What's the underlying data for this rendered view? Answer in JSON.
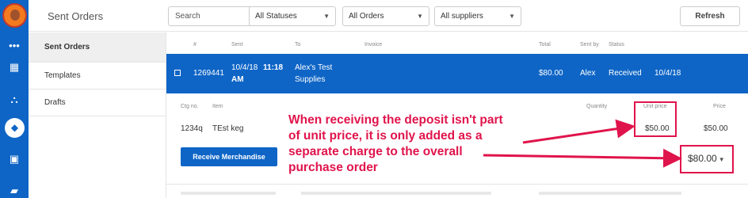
{
  "header": {
    "title": "Sent Orders",
    "search_placeholder": "Search",
    "status_filter": "All Statuses",
    "orders_filter": "All Orders",
    "suppliers_filter": "All suppliers",
    "refresh_label": "Refresh"
  },
  "sidebar": {
    "items": [
      {
        "label": "Sent Orders",
        "active": true
      },
      {
        "label": "Templates",
        "active": false
      },
      {
        "label": "Drafts",
        "active": false
      }
    ]
  },
  "table": {
    "columns": [
      "#",
      "Sent",
      "To",
      "Invoice",
      "Total",
      "Sent by",
      "Status"
    ],
    "selected_row": {
      "number": "1269441",
      "sent_date": "10/4/18",
      "sent_time": "11:18",
      "sent_ampm": "AM",
      "to_line1": "Alex's Test",
      "to_line2": "Supplies",
      "total": "$80.00",
      "sent_by": "Alex",
      "status": "Received",
      "status_date": "10/4/18"
    }
  },
  "detail": {
    "columns": [
      "Ctg no.",
      "Item",
      "Quantity",
      "Unit price",
      "Price"
    ],
    "row": {
      "ctg_no": "1234q",
      "item": "TEst keg",
      "unit_price": "$50.00",
      "price": "$50.00"
    },
    "receive_label": "Receive Merchandise",
    "order_total": "$80.00"
  },
  "annotation": {
    "line1": "When receiving the deposit isn't part",
    "line2": "of unit price, it is only added as a",
    "line3": "separate charge to the overall",
    "line4": "purchase order",
    "color": "#e0144c"
  },
  "icons": [
    "logo",
    "more-icon",
    "dashboard-icon",
    "basket-icon",
    "orders-icon",
    "archive-icon",
    "truck-icon",
    "checkbox-icon",
    "caret-down-icon"
  ],
  "colors": {
    "primary": "#0e65c6",
    "annotation": "#e0144c"
  }
}
